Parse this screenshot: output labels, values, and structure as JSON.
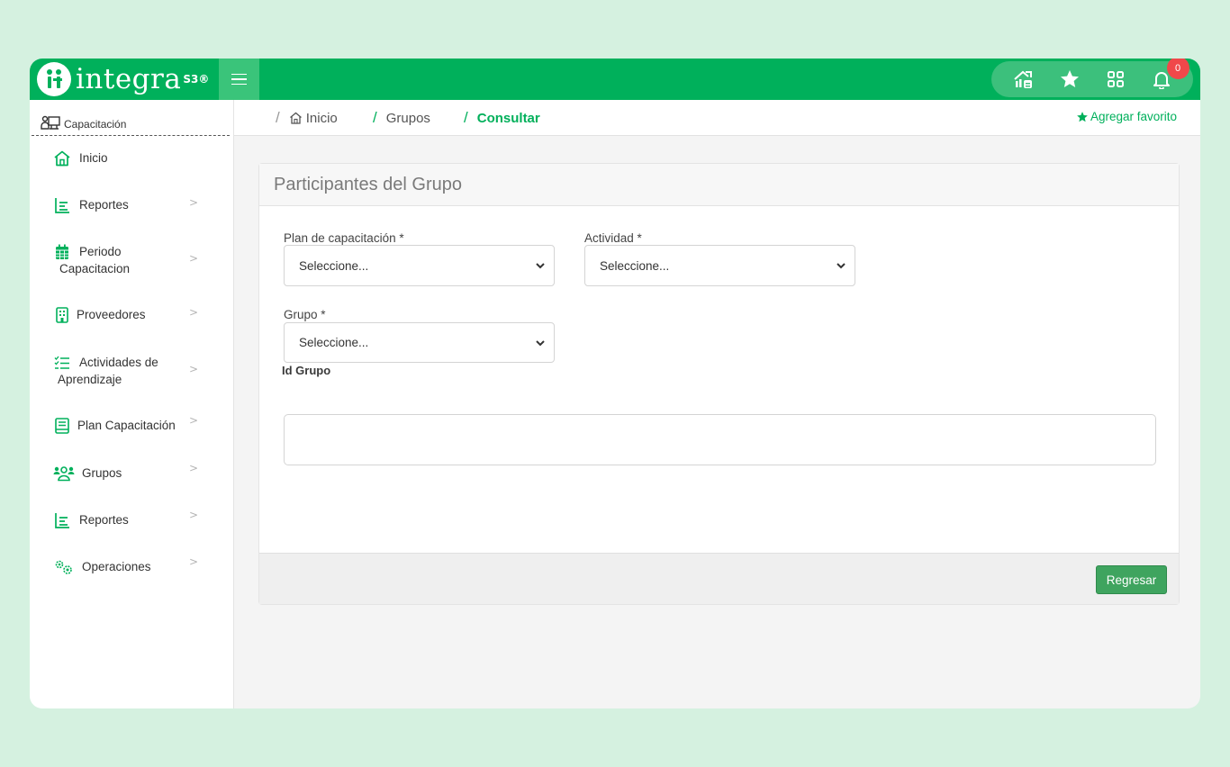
{
  "app": {
    "logo_text": "integra",
    "logo_mark": "S3®"
  },
  "header": {
    "notifications_count": "0",
    "icons": [
      "home-analytics-icon",
      "star-icon",
      "apps-grid-icon",
      "bell-icon"
    ]
  },
  "sidebar": {
    "title": "Capacitación",
    "items": [
      {
        "label": "Inicio",
        "icon": "home-icon",
        "has_chevron": false
      },
      {
        "label": "Reportes",
        "icon": "report-chart-icon",
        "has_chevron": true
      },
      {
        "label": "Periodo",
        "label2": "Capacitacion",
        "icon": "calendar-icon",
        "has_chevron": true
      },
      {
        "label": "Proveedores",
        "icon": "building-icon",
        "has_chevron": true
      },
      {
        "label": "Actividades de",
        "label2": "Aprendizaje",
        "icon": "checklist-icon",
        "has_chevron": true
      },
      {
        "label": "Plan Capacitación",
        "icon": "book-icon",
        "has_chevron": true
      },
      {
        "label": "Grupos",
        "icon": "group-icon",
        "has_chevron": true
      },
      {
        "label": "Reportes",
        "icon": "report-chart-icon",
        "has_chevron": true
      },
      {
        "label": "Operaciones",
        "icon": "gears-icon",
        "has_chevron": true
      }
    ]
  },
  "breadcrumb": {
    "items": [
      "Inicio",
      "Grupos",
      "Consultar"
    ],
    "favorite_label": "Agregar favorito"
  },
  "form": {
    "title": "Participantes del Grupo",
    "plan_label": "Plan de capacitación *",
    "plan_value": "Seleccione...",
    "actividad_label": "Actividad *",
    "actividad_value": "Seleccione...",
    "grupo_label": "Grupo *",
    "grupo_value": "Seleccione...",
    "id_grupo_label": "Id Grupo",
    "back_button": "Regresar"
  },
  "colors": {
    "brand": "#00b05b",
    "badge": "#f0484a",
    "button": "#3fa45f",
    "background": "#d5f1e0"
  }
}
